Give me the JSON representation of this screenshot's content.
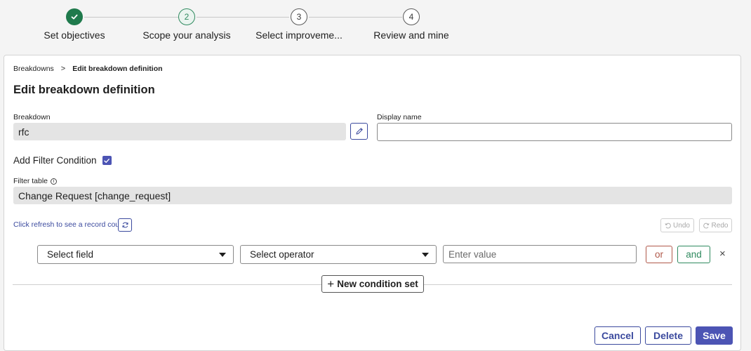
{
  "stepper": {
    "steps": [
      {
        "number": "",
        "label": "Set objectives",
        "state": "done"
      },
      {
        "number": "2",
        "label": "Scope your analysis",
        "state": "current"
      },
      {
        "number": "3",
        "label": "Select improveme...",
        "state": "todo"
      },
      {
        "number": "4",
        "label": "Review and mine",
        "state": "todo"
      }
    ]
  },
  "breadcrumb": {
    "parent": "Breakdowns",
    "separator": ">",
    "current": "Edit breakdown definition"
  },
  "page_title": "Edit breakdown definition",
  "breakdown": {
    "label": "Breakdown",
    "value": "rfc"
  },
  "display_name": {
    "label": "Display name",
    "value": "",
    "placeholder": ""
  },
  "filter_condition": {
    "label": "Add Filter Condition",
    "checked": true
  },
  "filter_table": {
    "label": "Filter table",
    "value": "Change Request [change_request]"
  },
  "record_count": {
    "link_text": "Click refresh to see a record count"
  },
  "history": {
    "undo_label": "Undo",
    "redo_label": "Redo"
  },
  "condition": {
    "field_placeholder": "Select field",
    "operator_placeholder": "Select operator",
    "value_placeholder": "Enter value",
    "or_label": "or",
    "and_label": "and",
    "remove_glyph": "×"
  },
  "new_condition_set": {
    "plus": "+",
    "label": "New condition set"
  },
  "footer": {
    "cancel_label": "Cancel",
    "delete_label": "Delete",
    "save_label": "Save"
  },
  "colors": {
    "accent": "#4c54b4",
    "step_done": "#1f7a4c",
    "or_color": "#b0584a",
    "and_color": "#2f8a5f"
  }
}
